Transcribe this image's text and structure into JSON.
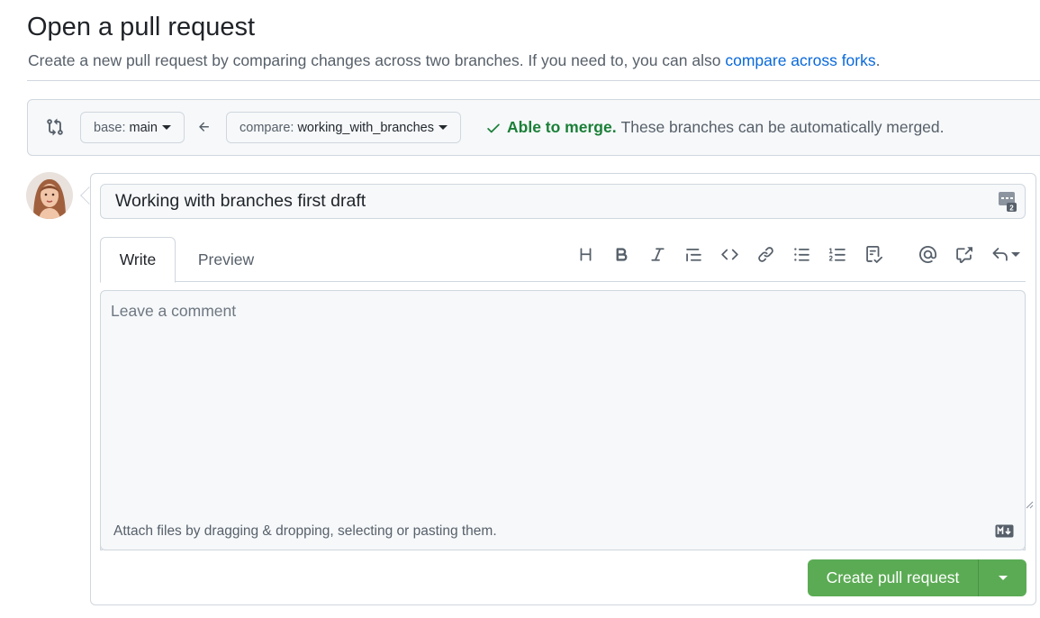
{
  "header": {
    "title": "Open a pull request",
    "subtitle": "Create a new pull request by comparing changes across two branches. If you need to, you can also ",
    "subtitle_link": "compare across forks",
    "subtitle_end": "."
  },
  "range": {
    "base_label": "base:",
    "base_value": "main",
    "compare_label": "compare:",
    "compare_value": "working_with_branches",
    "status_strong": "Able to merge.",
    "status_text": "These branches can be automatically merged."
  },
  "form": {
    "title_value": "Working with branches first draft",
    "tabs": [
      {
        "label": "Write"
      },
      {
        "label": "Preview"
      }
    ],
    "toolbar": [
      "heading-icon",
      "bold-icon",
      "italic-icon",
      "quote-icon",
      "code-icon",
      "link-icon",
      "unordered-list-icon",
      "ordered-list-icon",
      "task-list-icon",
      "mention-icon",
      "cross-reference-icon",
      "reply-icon"
    ],
    "comment_placeholder": "Leave a comment",
    "attach_text": "Attach files by dragging & dropping, selecting or pasting them.",
    "submit_label": "Create pull request"
  },
  "colors": {
    "accent_link": "#0969da",
    "success": "#1a7f37",
    "submit_bg": "#5bab54"
  }
}
